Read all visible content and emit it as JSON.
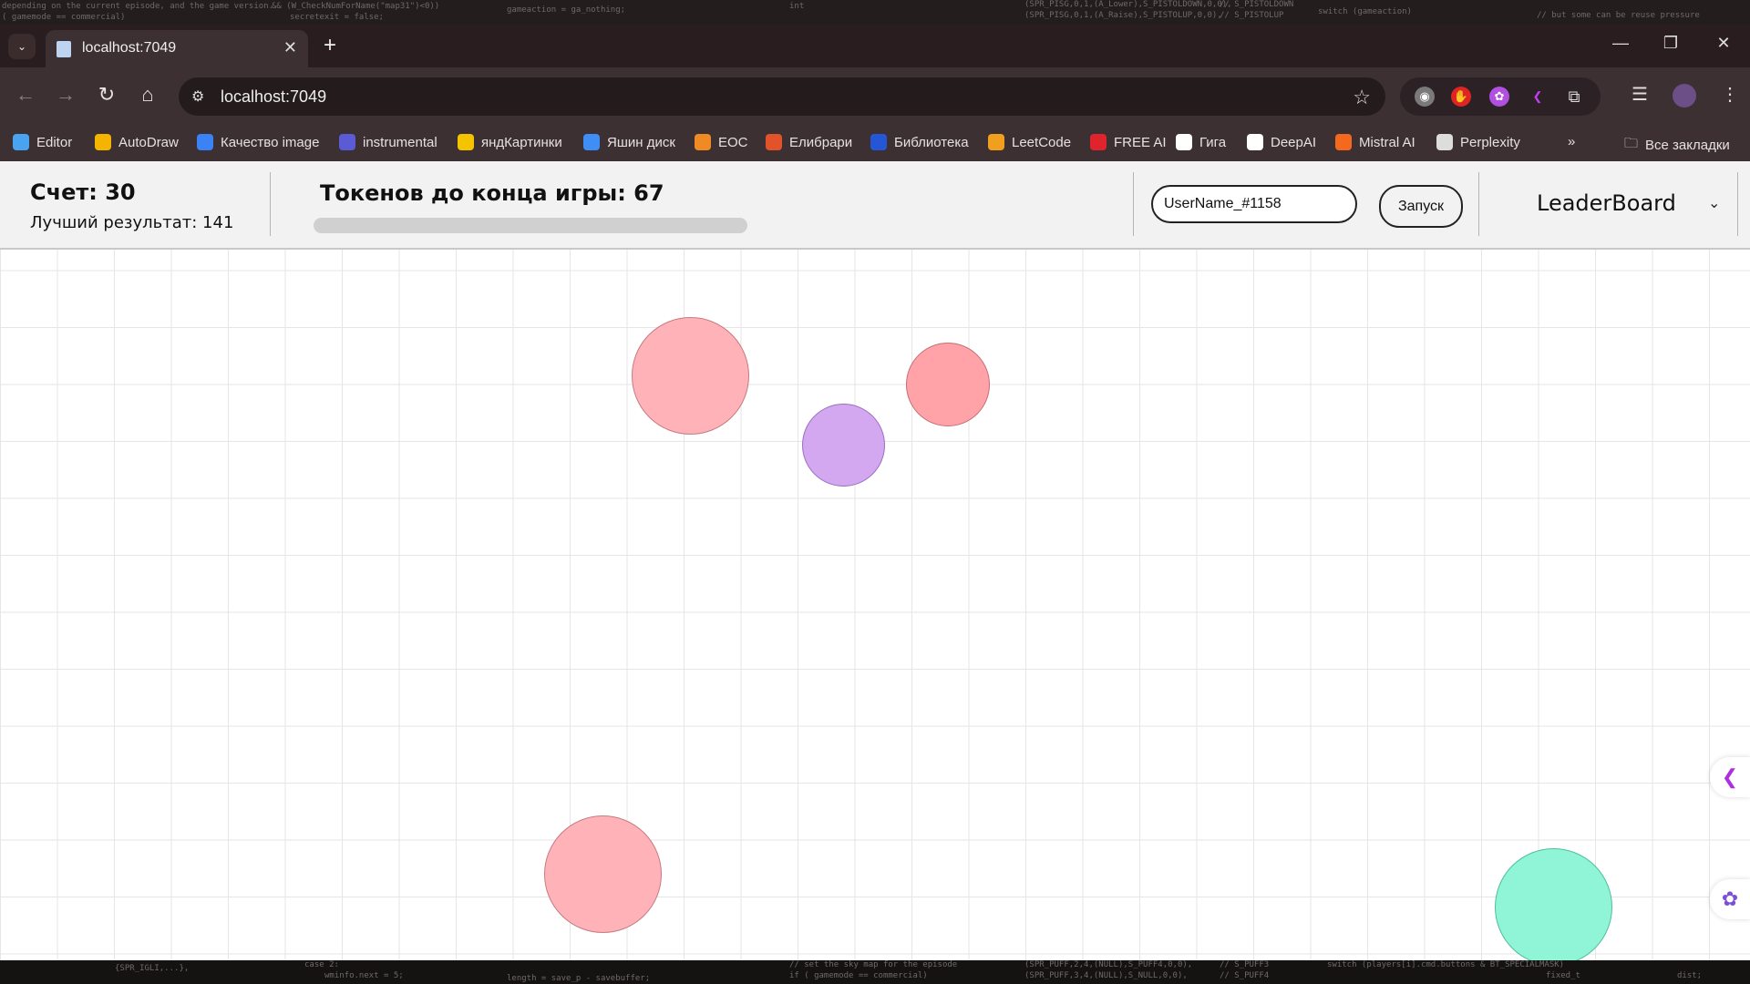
{
  "desktop": {
    "top_lines": [
      "depending on the current episode, and the game version.",
      "( gamemode == commercial)",
      "&& (W_CheckNumForName(\"map31\")<0))",
      "secretexit = false;",
      "gameaction = ga_nothing;",
      "int",
      "(SPR_PISG,0,1,(A_Lower),S_PISTOLDOWN,0,0),",
      "(SPR_PISG,0,1,(A_Raise),S_PISTOLUP,0,0),",
      "// S_PISTOLDOWN",
      "// S_PISTOLUP",
      "switch (gameaction)",
      "// but some can be reuse pressure"
    ],
    "bottom_lines": [
      "{SPR_IGLI,...},",
      "case 2:",
      "wminfo.next = 5;",
      "length = save_p - savebuffer;",
      "// set the sky map for the episode",
      "if ( gamemode == commercial)",
      "(SPR_PUFF,2,4,(NULL),S_PUFF4,0,0),",
      "(SPR_PUFF,3,4,(NULL),S_NULL,0,0),",
      "// S_PUFF3",
      "// S_PUFF4",
      "switch (players[i].cmd.buttons & BT_SPECIALMASK)",
      "fixed_t",
      "dist;"
    ]
  },
  "browser": {
    "tab_title": "localhost:7049",
    "url": "localhost:7049",
    "bookmarks": [
      {
        "label": "Editor",
        "icon": "editor-icon",
        "color": "#4aa3f0"
      },
      {
        "label": "AutoDraw",
        "icon": "autodraw-icon",
        "color": "#f4b400"
      },
      {
        "label": "Качество image",
        "icon": "quality-image-icon",
        "color": "#3b82f6"
      },
      {
        "label": "instrumental",
        "icon": "instrumental-icon",
        "color": "#5b5bd6"
      },
      {
        "label": "яндКартинки",
        "icon": "yandex-images-icon",
        "color": "#f5c400"
      },
      {
        "label": "Яшин диск",
        "icon": "yandex-disk-icon",
        "color": "#3f8ef5"
      },
      {
        "label": "EOC",
        "icon": "eoc-icon",
        "color": "#f08a24"
      },
      {
        "label": "Елибрари",
        "icon": "elibrary-icon",
        "color": "#e2532b"
      },
      {
        "label": "Библиотека",
        "icon": "library-icon",
        "color": "#2456d6"
      },
      {
        "label": "LeetCode",
        "icon": "leetcode-icon",
        "color": "#f0a01e"
      },
      {
        "label": "FREE AI",
        "icon": "free-ai-icon",
        "color": "#e0242e"
      },
      {
        "label": "Гига",
        "icon": "giga-icon",
        "color": "#ffffff"
      },
      {
        "label": "DeepAI",
        "icon": "deepai-icon",
        "color": "#ffffff"
      },
      {
        "label": "Mistral AI",
        "icon": "mistral-icon",
        "color": "#f5691e"
      },
      {
        "label": "Perplexity",
        "icon": "perplexity-icon",
        "color": "#dddddd"
      }
    ],
    "all_bookmarks_label": "Все закладки"
  },
  "game": {
    "score_text": "Счет: 30",
    "best_text": "Лучший результат: 141",
    "tokens_text": "Токенов до конца игры: 67",
    "progress_fraction": 0,
    "username_value": "UserName_#1158",
    "launch_label": "Запуск",
    "leaderboard_label": "LeaderBoard"
  },
  "colors": {
    "ball_pink": "#ffb3b8",
    "ball_pink_dark": "#ffa3a8",
    "ball_purple": "#d3a8f0",
    "ball_green": "#8ff5d6"
  }
}
